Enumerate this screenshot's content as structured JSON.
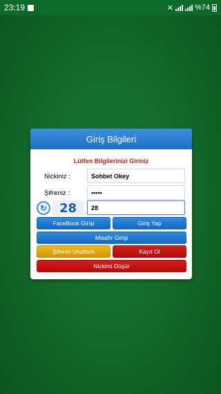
{
  "status_bar": {
    "time": "23:19",
    "battery_text": "%74"
  },
  "dialog": {
    "title": "Giriş Bilgileri",
    "subtitle": "Lütfen Bilgilerinizi Giriniz",
    "nick_label": "Nickiniz :",
    "nick_value": "Sohbet Okey",
    "password_label": "Şifreniz :",
    "password_value": "•••••",
    "captcha_code": "28",
    "captcha_value": "28",
    "buttons": {
      "facebook": "FaceBook Girişi",
      "login": "Giriş Yap",
      "guest": "Misafır Girişi",
      "forgot": "Şifremi Unuttum",
      "register": "Kayıt Ol",
      "drop_nick": "Nickimi Düşür"
    }
  },
  "colors": {
    "background": "#136b2c",
    "header_blue": "#2577cc",
    "button_blue": "#1f78d1",
    "button_yellow": "#e3a712",
    "button_red": "#c41515",
    "subtitle_red": "#c01c1c"
  }
}
